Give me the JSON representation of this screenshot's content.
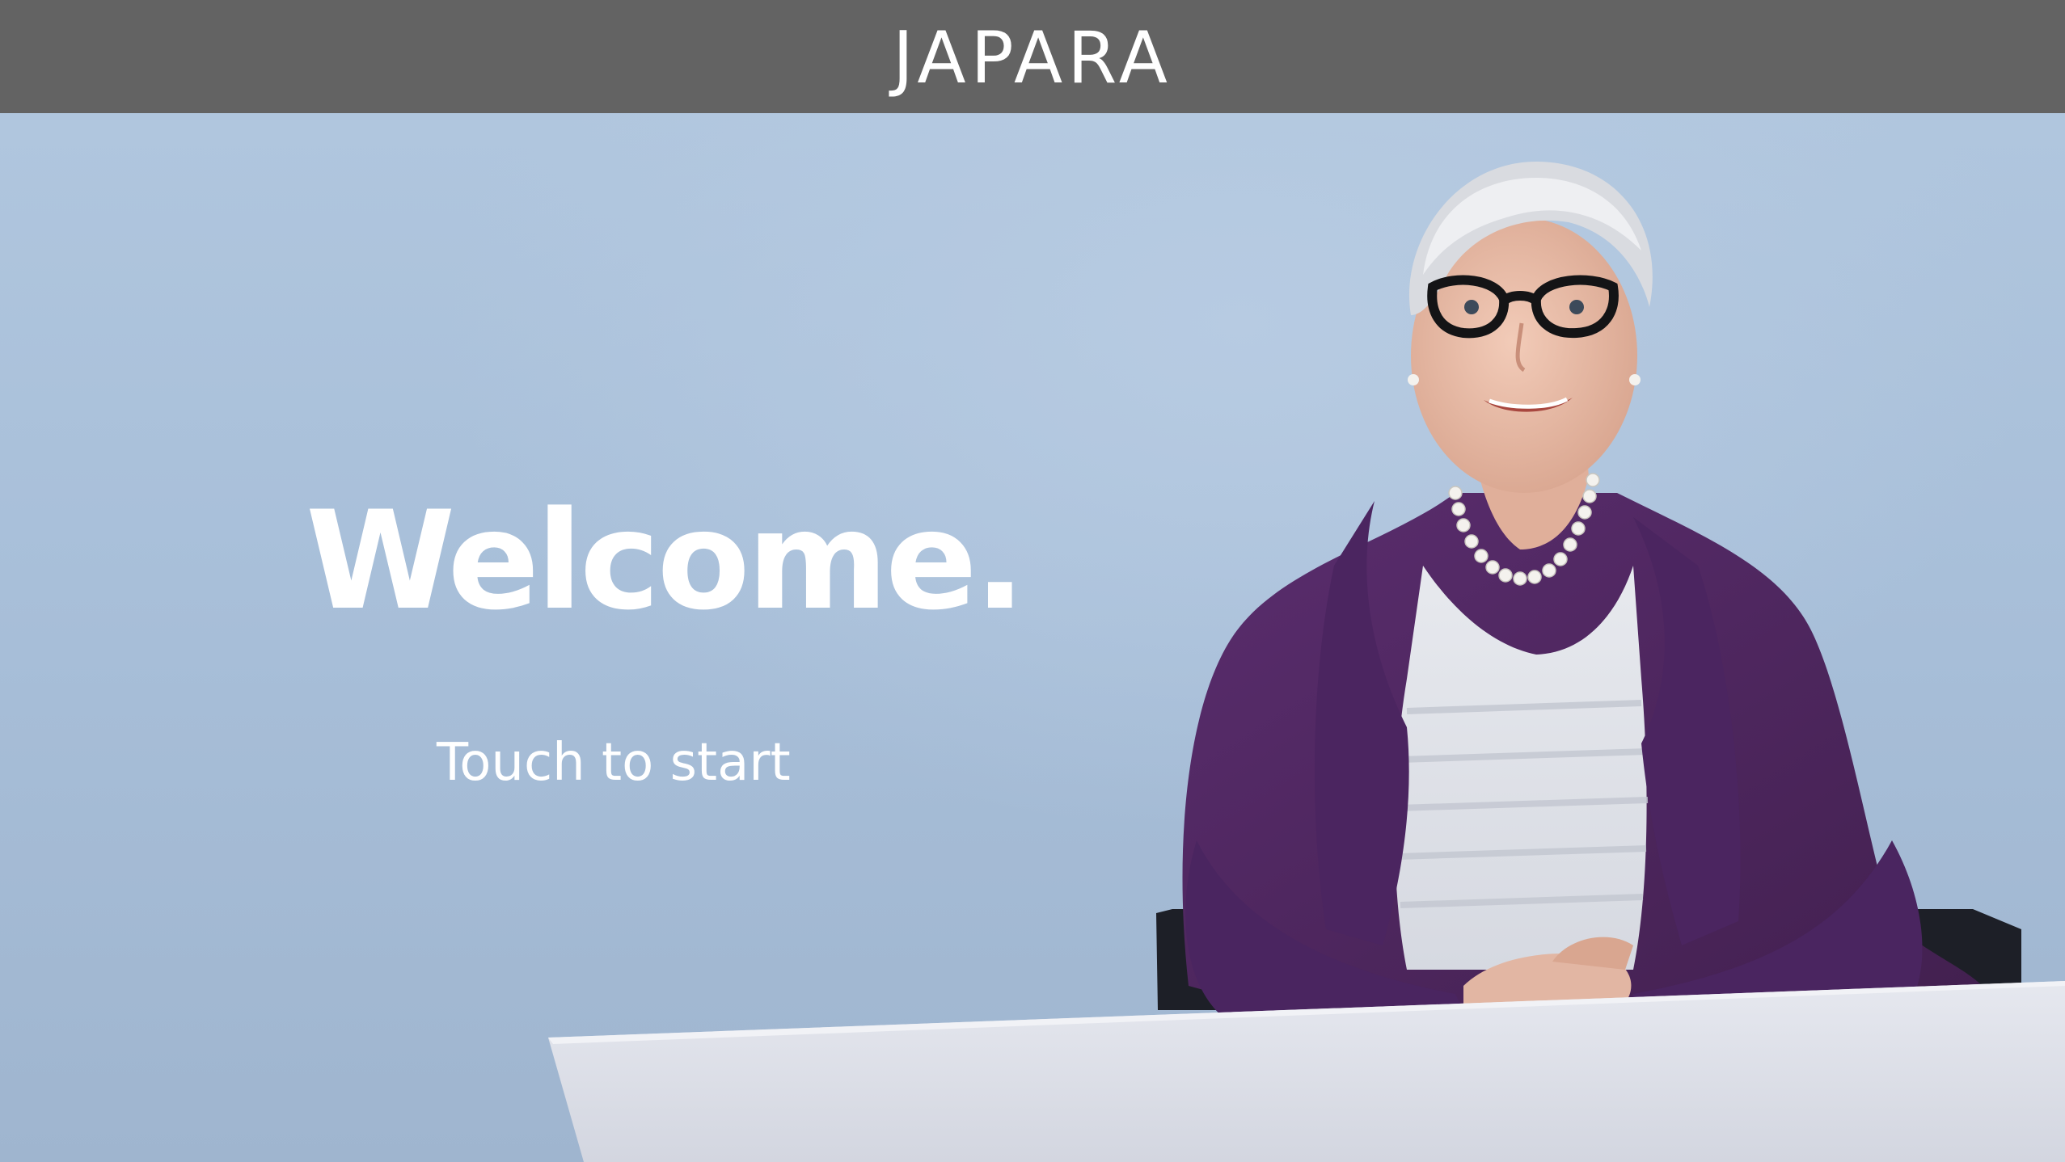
{
  "header": {
    "brand": "JAPARA",
    "background": "#636363"
  },
  "main": {
    "welcome_text": "Welcome.",
    "touch_prompt": "Touch to start",
    "background": "#aabfd8",
    "photo_subject": "smiling-elderly-woman-in-purple-cardigan-at-table"
  }
}
